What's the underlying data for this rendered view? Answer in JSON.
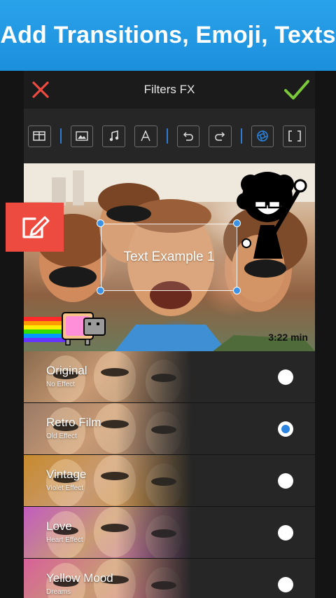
{
  "banner": {
    "title": "Add Transitions, Emoji, Texts"
  },
  "topbar": {
    "title": "Filters FX",
    "close_icon": "close-x-icon",
    "ok_icon": "checkmark-icon"
  },
  "toolbar": {
    "tools": [
      "layout-icon",
      "image-icon",
      "music-note-icon",
      "text-A-icon",
      "undo-icon",
      "redo-icon",
      "filter-aperture-icon",
      "crop-brackets-icon"
    ],
    "active_color": "#2a84e0"
  },
  "preview": {
    "text_overlay": "Text Example 1",
    "duration": "3:22 min",
    "stickers": [
      "afro-guy-sticker",
      "nyan-cat-sticker"
    ]
  },
  "edit_button": {
    "icon": "edit-pencil-icon",
    "color": "#ee4b40"
  },
  "filters": [
    {
      "name": "Original",
      "desc": "No Effect",
      "selected": false,
      "tint": "#8a6a4e"
    },
    {
      "name": "Retro Film",
      "desc": "Old Effect",
      "selected": true,
      "tint": "#9a7a66"
    },
    {
      "name": "Vintage",
      "desc": "Violet Effect",
      "selected": false,
      "tint": "#c78a2c"
    },
    {
      "name": "Love",
      "desc": "Heart Effect",
      "selected": false,
      "tint": "#c25cc0"
    },
    {
      "name": "Yellow Mood",
      "desc": "Dreams",
      "selected": false,
      "tint": "#d8609a"
    }
  ]
}
